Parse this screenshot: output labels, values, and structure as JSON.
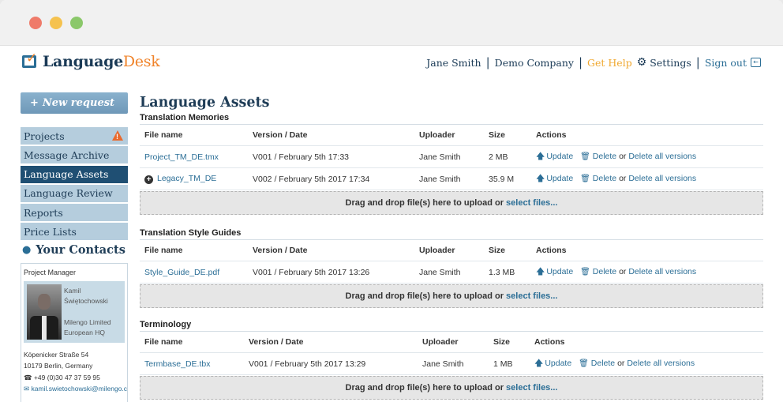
{
  "header": {
    "logo_main": "Language",
    "logo_accent": "Desk",
    "user_name": "Jane Smith",
    "company": "Demo Company",
    "help": "Get Help",
    "settings": "Settings",
    "signout": "Sign out"
  },
  "sidebar": {
    "new_request": "New request",
    "items": [
      {
        "label": "Projects"
      },
      {
        "label": "Message Archive"
      },
      {
        "label": "Language Assets"
      },
      {
        "label": "Language Review"
      },
      {
        "label": "Reports"
      },
      {
        "label": "Price Lists"
      }
    ],
    "contacts_title": "Your Contacts",
    "contact": {
      "role": "Project Manager",
      "first_name": "Kamil",
      "last_name": "Świętochowski",
      "company_line1": "Milengo Limited",
      "company_line2": "European HQ",
      "address1": "Köpenicker Straße 54",
      "address2": "10179 Berlin, Germany",
      "phone": "+49 (0)30 47 37 59 95",
      "email": "kamil.swietochowski@milengo.c"
    }
  },
  "main": {
    "title": "Language Assets",
    "columns": {
      "file": "File name",
      "version": "Version / Date",
      "uploader": "Uploader",
      "size": "Size",
      "actions": "Actions"
    },
    "action_labels": {
      "update": "Update",
      "delete": "Delete",
      "or": "or",
      "delete_all": "Delete all versions"
    },
    "dropzone": {
      "text": "Drag and drop file(s) here to upload or",
      "link": "select files..."
    },
    "sections": [
      {
        "title": "Translation Memories",
        "rows": [
          {
            "file": "Project_TM_DE.tmx",
            "version": "V001 / February 5th 17:33",
            "uploader": "Jane Smith",
            "size": "2 MB"
          },
          {
            "file": "Legacy_TM_DE",
            "version": "V002 / February 5th 2017 17:34",
            "uploader": "Jane Smith",
            "size": "35.9 M"
          }
        ]
      },
      {
        "title": "Translation Style Guides",
        "rows": [
          {
            "file": "Style_Guide_DE.pdf",
            "version": "V001 / February 5th 2017 13:26",
            "uploader": "Jane Smith",
            "size": "1.3 MB"
          }
        ]
      },
      {
        "title": "Terminology",
        "rows": [
          {
            "file": "Termbase_DE.tbx",
            "version": "V001 / February 5th 2017 13:29",
            "uploader": "Jane Smith",
            "size": "1 MB"
          }
        ]
      }
    ]
  }
}
